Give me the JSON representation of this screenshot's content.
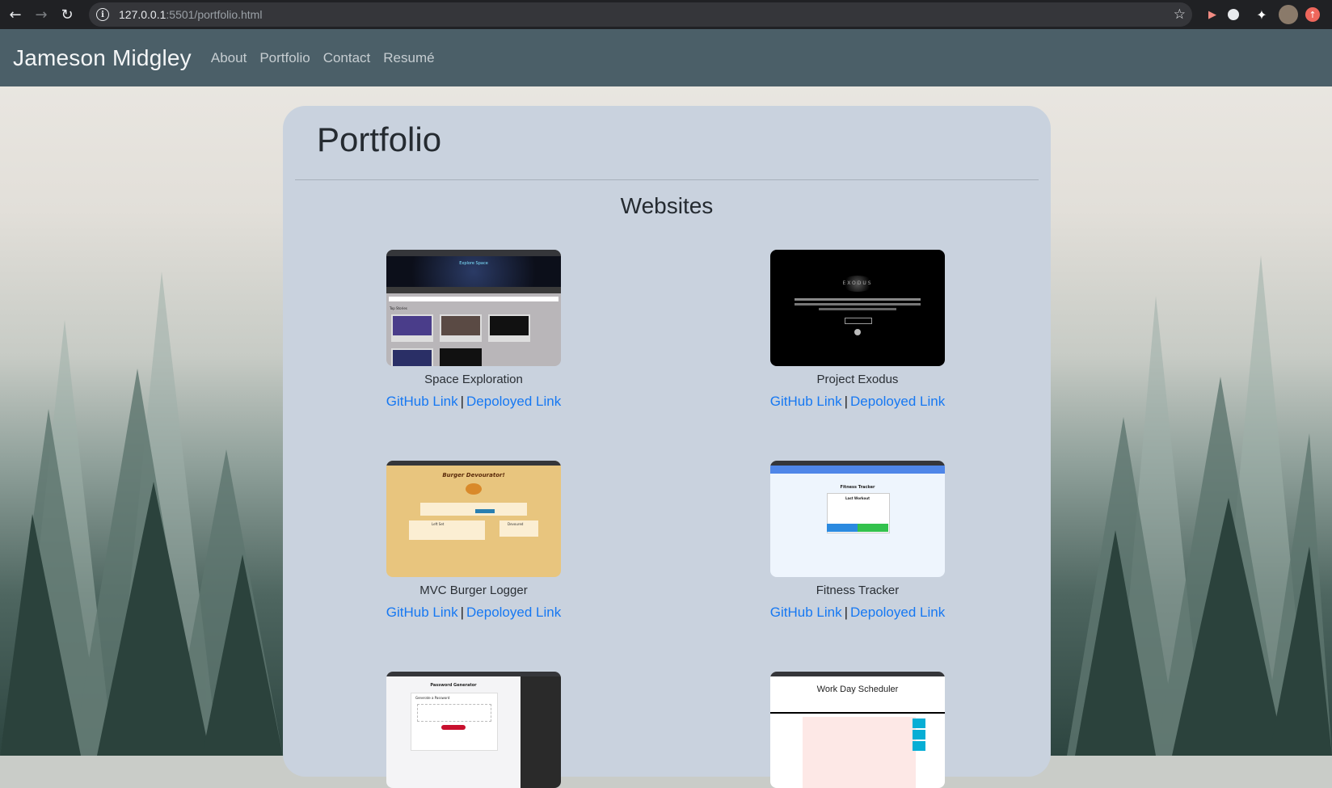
{
  "browser": {
    "url_host": "127.0.0.1",
    "url_rest": ":5501/portfolio.html"
  },
  "site": {
    "brand": "Jameson Midgley",
    "nav": [
      "About",
      "Portfolio",
      "Contact",
      "Resumé"
    ]
  },
  "page": {
    "title": "Portfolio",
    "section_title": "Websites"
  },
  "projects": [
    {
      "name": "Space Exploration",
      "github_label": "GitHub Link",
      "deploy_label": "Depoloyed Link",
      "thumb_heading": "Explore Space",
      "thumb_section": "Top Stories"
    },
    {
      "name": "Project Exodus",
      "github_label": "GitHub Link",
      "deploy_label": "Depoloyed Link",
      "thumb_heading": "EXODUS"
    },
    {
      "name": "MVC Burger Logger",
      "github_label": "GitHub Link",
      "deploy_label": "Depoloyed Link",
      "thumb_heading": "Burger Devourator!",
      "thumb_col1": "Left Set",
      "thumb_col2": "Devoured"
    },
    {
      "name": "Fitness Tracker",
      "github_label": "GitHub Link",
      "deploy_label": "Depoloyed Link",
      "thumb_heading": "Fitness Tracker",
      "thumb_sub": "Last Workout"
    },
    {
      "name": "Password Generator",
      "thumb_heading": "Password Generator",
      "thumb_sub": "Generate a Password"
    },
    {
      "name": "Work Day Scheduler",
      "thumb_heading": "Work Day Scheduler"
    }
  ],
  "colors": {
    "navbar": "#4b5f68",
    "card": "#c9d2de",
    "link": "#1678f2"
  }
}
